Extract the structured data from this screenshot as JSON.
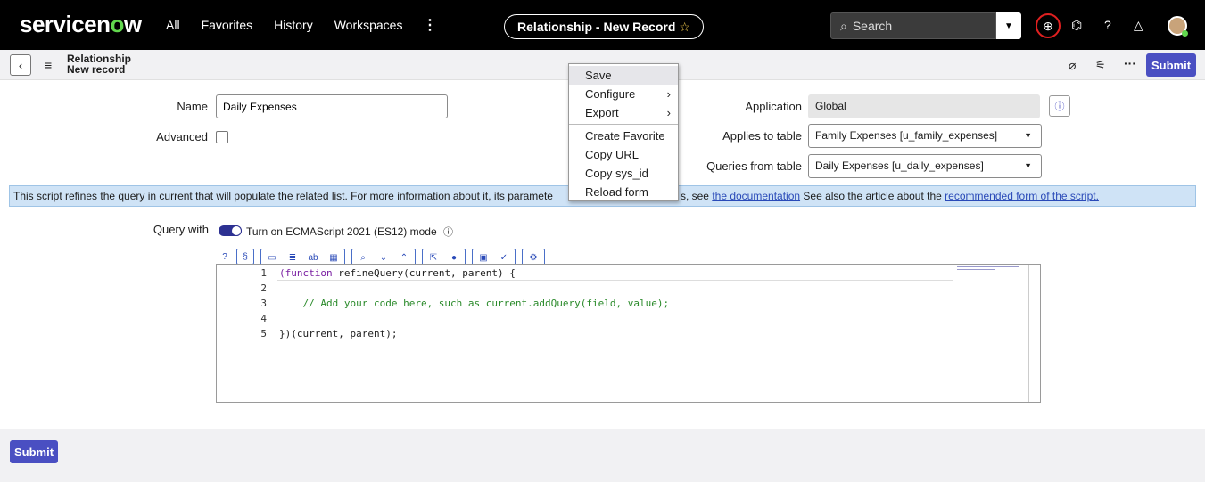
{
  "topnav": {
    "logo_pre": "servicen",
    "logo_o": "o",
    "logo_post": "w",
    "links": [
      "All",
      "Favorites",
      "History",
      "Workspaces"
    ],
    "kebab": "⋮",
    "record_pill": "Relationship - New Record",
    "search_placeholder": "Search"
  },
  "record_header": {
    "title_line1": "Relationship",
    "title_line2": "New record",
    "submit_label": "Submit"
  },
  "form": {
    "name_label": "Name",
    "name_value": "Daily Expenses",
    "advanced_label": "Advanced",
    "application_label": "Application",
    "application_value": "Global",
    "applies_label": "Applies to table",
    "applies_value": "Family Expenses [u_family_expenses]",
    "queries_label": "Queries from table",
    "queries_value": "Daily Expenses [u_daily_expenses]"
  },
  "infobar": {
    "text_start": "This script refines the query in current that will populate the related list. For more information about it, its paramete",
    "text_mid": "s, see ",
    "link1": "the documentation",
    "text_after": " See also the article about the ",
    "link2": "recommended form of the script."
  },
  "query": {
    "label": "Query with",
    "toggle_text": "Turn on ECMAScript 2021 (ES12) mode"
  },
  "editor": {
    "line_numbers": [
      "1",
      "2",
      "3",
      "4",
      "5"
    ],
    "line1_kw": "(function",
    "line1_rest": " refineQuery(current, parent) {",
    "line3": "    // Add your code here, such as current.addQuery(field, value);",
    "line5": "})(current, parent);"
  },
  "bottom": {
    "submit_label": "Submit"
  },
  "context_menu": {
    "save": "Save",
    "configure": "Configure",
    "export": "Export",
    "create_favorite": "Create Favorite",
    "copy_url": "Copy URL",
    "copy_sys_id": "Copy sys_id",
    "reload_form": "Reload form",
    "highlighted_item": "Save"
  },
  "colors": {
    "accent": "#4a4fc2",
    "logo_green": "#62d84e",
    "info_bg": "#cfe3f6"
  }
}
